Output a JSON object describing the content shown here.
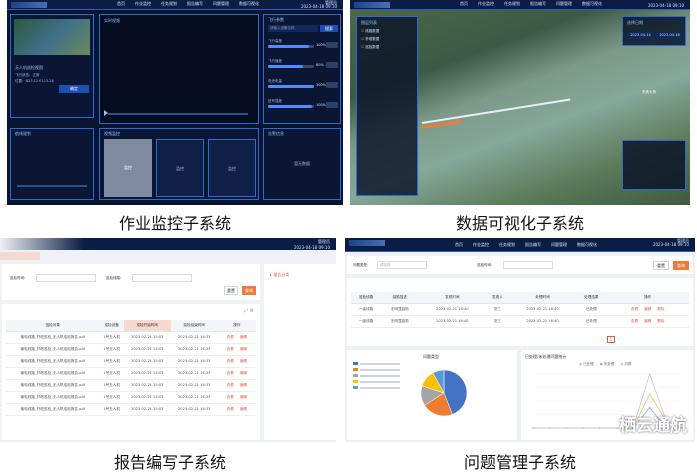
{
  "captions": {
    "monitoring": "作业监控子系统",
    "visualization": "数据可视化子系统",
    "report": "报告编写子系统",
    "issues": "问题管理子系统"
  },
  "watermark": "栖云通航",
  "colors": {
    "dark_bg": "#0a1634",
    "accent_blue": "#2f6ad0",
    "orange": "#f07a3a",
    "link_red": "#e25a3a"
  },
  "monitoring": {
    "nav": [
      "首页",
      "作业监控",
      "任务规划",
      "报告编写",
      "问题管理",
      "数据可视化"
    ],
    "user": "管理员",
    "datetime": "2023-04-18 09:10",
    "map_title": "无人机巡检视图",
    "cam_title": "实时视频",
    "status_title": "设备状态",
    "right_title": "飞行参数",
    "search_ph": "请输入设备名称",
    "search_btn": "搜索",
    "confirm_btn": "确定",
    "lower_titles": [
      "航线规划",
      "视频监控",
      "告警信息"
    ],
    "tiles": [
      "监控",
      "监控",
      "监控"
    ],
    "alert_text": "暂无数据",
    "params": [
      {
        "label": "飞行高度",
        "value": "100%",
        "level": 0.9
      },
      {
        "label": "飞行速度",
        "value": "80%",
        "level": 0.75
      },
      {
        "label": "电池电量",
        "value": "100%",
        "level": 1.0
      },
      {
        "label": "信号强度",
        "value": "100%",
        "level": 0.95
      }
    ],
    "info_lines": [
      "飞行状态：正常",
      "位置：N23.12 E113.28"
    ]
  },
  "visualization": {
    "nav": [
      "首页",
      "作业监控",
      "任务规划",
      "报告编写",
      "问题管理",
      "数据可视化"
    ],
    "datetime": "2023-04-18 09:10",
    "tree_title": "图层列表",
    "tree_items": [
      "线路数据",
      "杆塔数据",
      "巡检数据"
    ],
    "date_title": "选择日期",
    "date_from": "2023-04-14",
    "date_to": "2023-04-18",
    "map_label": "东莞大桥"
  },
  "report": {
    "user": "管理员",
    "datetime": "2023-04-18 09:10",
    "filter_label1": "巡检时间：",
    "filter_label2": "巡检线路：",
    "reset_btn": "重置",
    "query_btn": "查询",
    "side_item": "报告分类",
    "columns": [
      "巡检对象",
      "巡检设备",
      "巡检开始时间",
      "巡检结束时间",
      "操作"
    ],
    "rows": [
      [
        "输电线路_杆塔巡检_无人机巡检报告.pdf",
        "1号无人机",
        "2023-02-21 15:03",
        "2023-02-21 16:33"
      ],
      [
        "输电线路_杆塔巡检_无人机巡检报告.pdf",
        "1号无人机",
        "2023-02-21 15:03",
        "2023-02-21 16:33"
      ],
      [
        "输电线路_杆塔巡检_无人机巡检报告.pdf",
        "1号无人机",
        "2023-02-21 15:03",
        "2023-02-21 16:33"
      ],
      [
        "输电线路_杆塔巡检_无人机巡检报告.pdf",
        "1号无人机",
        "2023-02-21 15:03",
        "2023-02-21 16:33"
      ],
      [
        "输电线路_杆塔巡检_无人机巡检报告.pdf",
        "1号无人机",
        "2023-02-21 15:03",
        "2023-02-21 16:33"
      ],
      [
        "输电线路_杆塔巡检_无人机巡检报告.pdf",
        "1号无人机",
        "2023-02-21 15:03",
        "2023-02-21 16:33"
      ],
      [
        "输电线路_杆塔巡检_无人机巡检报告.pdf",
        "1号无人机",
        "2023-02-21 15:03",
        "2023-02-21 16:33"
      ]
    ],
    "actions": [
      "查看",
      "编辑"
    ]
  },
  "issues": {
    "nav": [
      "首页",
      "作业监控",
      "任务规划",
      "报告编写",
      "问题管理",
      "数据可视化"
    ],
    "user": "管理员",
    "datetime": "2023-04-18 09:10",
    "filter_label1": "问题类型：",
    "filter_label2": "巡检时间：",
    "filter_ph": "请选择",
    "reset_btn": "重置",
    "query_btn": "查询",
    "columns": [
      "巡检线路",
      "缺陷描述",
      "发现时间",
      "发现人",
      "处理时间",
      "处理结果",
      "操作"
    ],
    "rows": [
      [
        "一级线路",
        "无明显缺陷",
        "2023-02-21 16:40",
        "张三",
        "2023-02-21 16:40",
        "已处理"
      ],
      [
        "一级线路",
        "无明显缺陷",
        "2023-02-21 16:40",
        "张三",
        "2023-02-21 16:40",
        "已处理"
      ]
    ],
    "actions": [
      "查看",
      "编辑",
      "删除"
    ],
    "pager": "1",
    "pie_panel_title": "问题类型",
    "line_panel_title": "已处理/未处理问题统计",
    "legend": [
      "已处理",
      "未处理",
      "总数"
    ]
  },
  "chart_data": [
    {
      "type": "pie",
      "title": "问题类型",
      "categories": [
        "",
        "",
        "",
        "",
        ""
      ],
      "values": [
        44,
        22,
        14,
        12,
        8
      ],
      "colors": [
        "#4472c4",
        "#ed7d31",
        "#a5a5a5",
        "#ffc000",
        "#5b9bd5"
      ]
    },
    {
      "type": "line",
      "title": "已处理/未处理问题统计",
      "x": [
        1,
        2,
        3,
        4,
        5,
        6,
        7,
        8,
        9,
        10
      ],
      "series": [
        {
          "name": "已处理",
          "values": [
            0,
            0,
            0,
            0,
            0,
            0,
            0,
            5,
            1,
            0
          ],
          "color": "#f0c060"
        },
        {
          "name": "未处理",
          "values": [
            0,
            0,
            0,
            0,
            0,
            0,
            0,
            3,
            0,
            0
          ],
          "color": "#7fb4e8"
        },
        {
          "name": "总数",
          "values": [
            0,
            0,
            0,
            0,
            0,
            0,
            0,
            8,
            1,
            0
          ],
          "color": "#c9c9c9"
        }
      ],
      "ylim": [
        0,
        8
      ]
    }
  ]
}
